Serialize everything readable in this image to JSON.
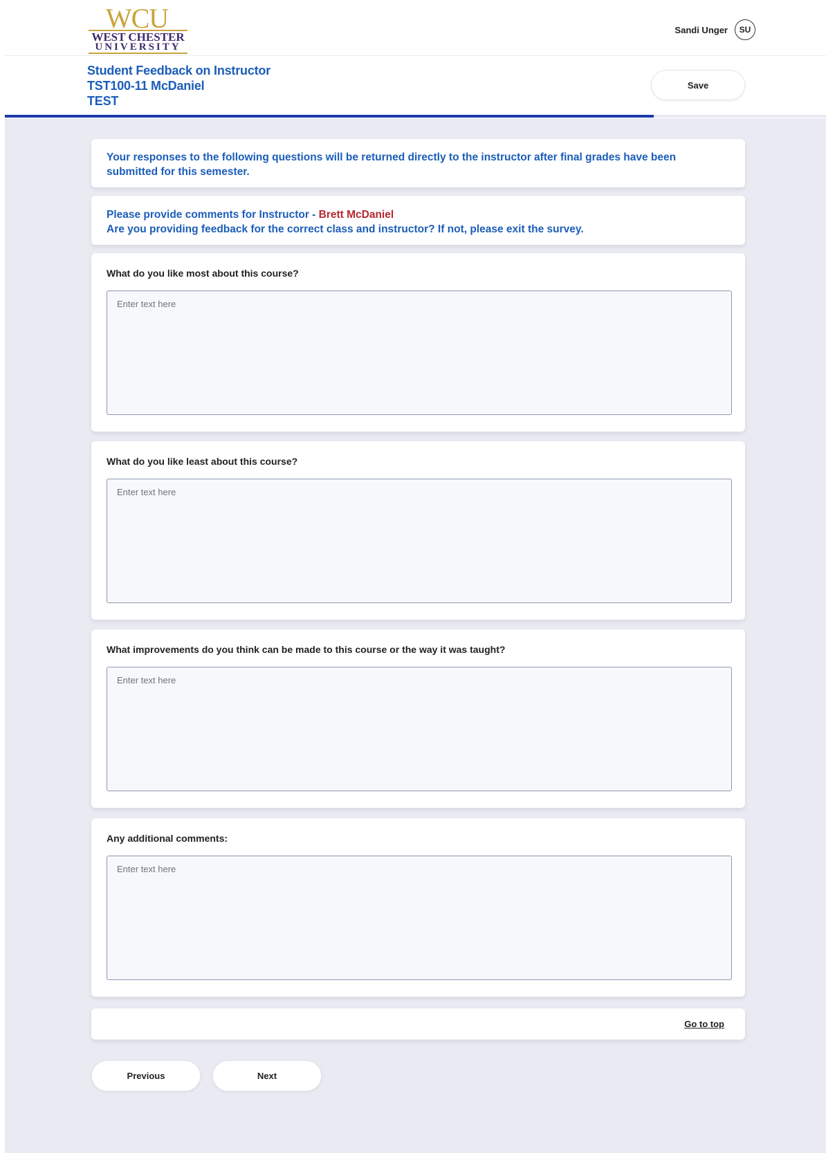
{
  "logo": {
    "mark": "WCU",
    "line1": "WEST CHESTER",
    "line2": "UNIVERSITY"
  },
  "user": {
    "name": "Sandi Unger",
    "initials": "SU"
  },
  "header": {
    "title_line1": "Student Feedback on Instructor",
    "title_line2": "TST100-11 McDaniel",
    "title_line3": "TEST",
    "save_label": "Save",
    "progress_fraction": 0.79
  },
  "notice": {
    "text": "Your responses to the following questions will be returned directly to the instructor after final grades have been submitted for this semester."
  },
  "instructor": {
    "prompt_prefix": "Please provide comments for Instructor - ",
    "name": "Brett McDaniel",
    "confirm": "Are you providing feedback for the correct class and instructor? If not, please exit the survey."
  },
  "questions": [
    {
      "label": "What do you like most about this course?",
      "value": "",
      "placeholder": "Enter text here"
    },
    {
      "label": "What do you like least about this course?",
      "value": "",
      "placeholder": "Enter text here"
    },
    {
      "label": "What improvements do you think can be made to this course or the way it was taught?",
      "value": "",
      "placeholder": "Enter text here"
    },
    {
      "label": "Any additional comments:",
      "value": "",
      "placeholder": "Enter text here"
    }
  ],
  "footer": {
    "go_to_top": "Go to top",
    "previous_label": "Previous",
    "next_label": "Next"
  },
  "colors": {
    "brand_blue": "#1c5db8",
    "progress": "#1c3aa8",
    "instructor_name": "#b3292e",
    "logo_gold": "#c9a43a",
    "logo_purple": "#3c2a6e",
    "background": "#e9eaf2"
  }
}
